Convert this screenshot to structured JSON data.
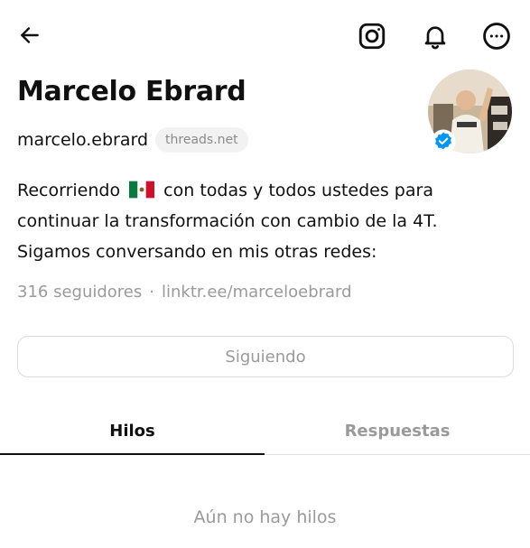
{
  "header": {
    "back_icon": "arrow-left-icon",
    "instagram_icon": "instagram-icon",
    "notifications_icon": "bell-icon",
    "more_icon": "more-options-icon"
  },
  "profile": {
    "name": "Marcelo Ebrard",
    "handle": "marcelo.ebrard",
    "domain": "threads.net",
    "verified": true,
    "bio_lines": [
      {
        "before": "Recorriendo",
        "flag": "mexico-flag",
        "after": "con todas y todos ustedes para"
      },
      "continuar la transformación con cambio de la 4T.",
      "Sigamos conversando en mis otras redes:"
    ],
    "followers": "316 seguidores",
    "separator": "·",
    "link": "linktr.ee/marceloebrard"
  },
  "follow_button": {
    "label": "Siguiendo"
  },
  "tabs": [
    {
      "label": "Hilos",
      "active": true
    },
    {
      "label": "Respuestas",
      "active": false
    }
  ],
  "empty_state": "Aún no hay hilos",
  "colors": {
    "text": "#101010",
    "muted": "#9a9a9a",
    "verified": "#0095f6",
    "border": "#dcdcdc"
  }
}
